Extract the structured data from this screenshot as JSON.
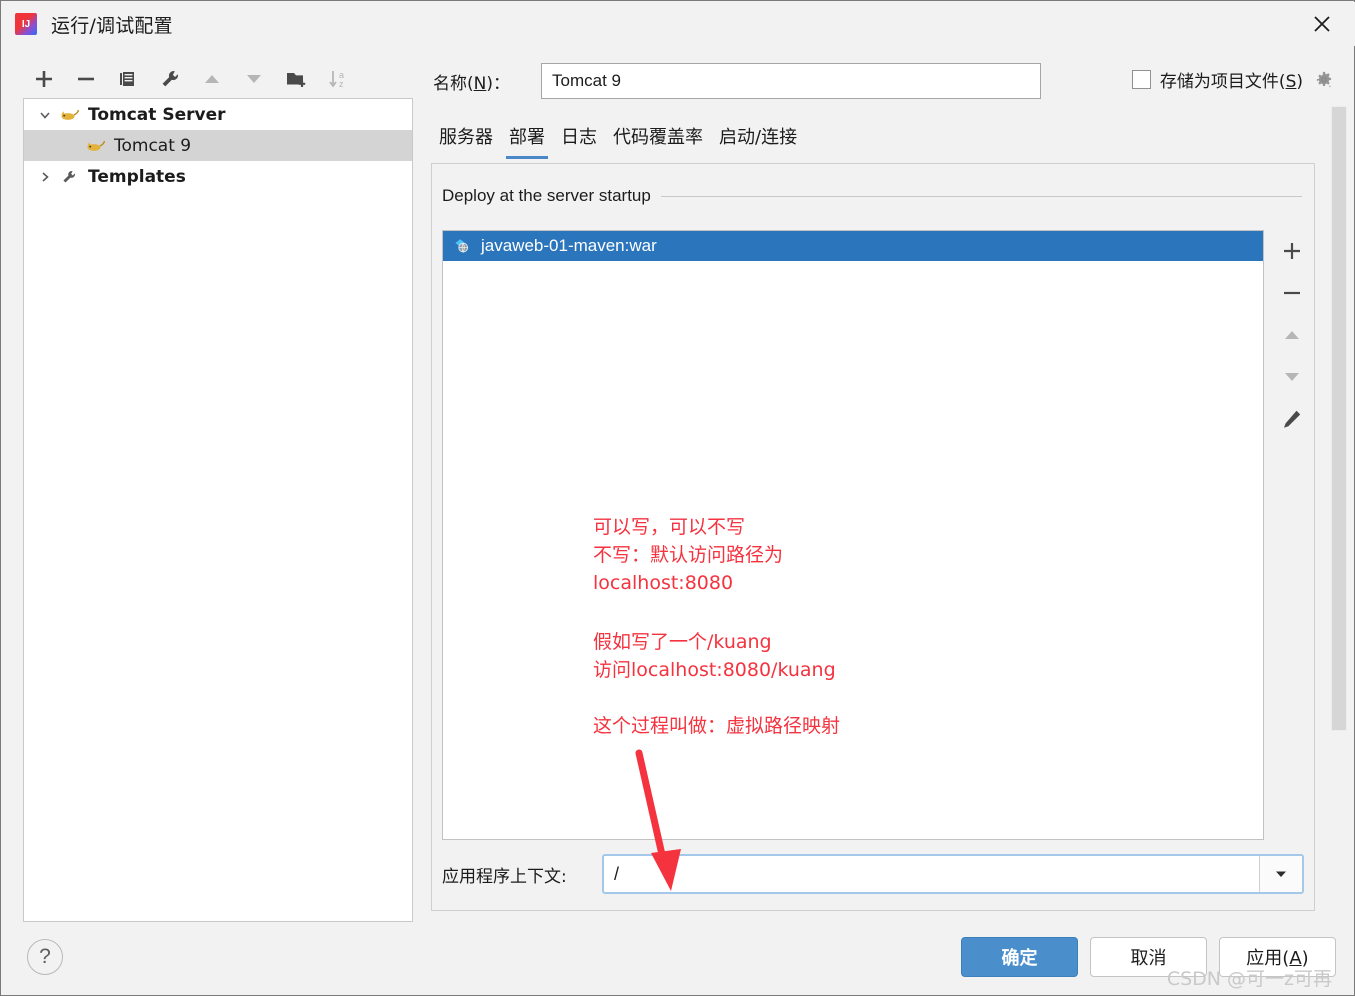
{
  "window": {
    "title": "运行/调试配置",
    "app_icon": "intellij-idea-icon",
    "close_label": "×"
  },
  "left_toolbar": {
    "buttons": [
      {
        "name": "add-configuration-button",
        "icon": "plus-icon",
        "enabled": true
      },
      {
        "name": "remove-configuration-button",
        "icon": "minus-icon",
        "enabled": true
      },
      {
        "name": "copy-configuration-button",
        "icon": "copy-icon",
        "enabled": true
      },
      {
        "name": "edit-templates-button",
        "icon": "wrench-icon",
        "enabled": true
      },
      {
        "name": "move-up-button",
        "icon": "arrow-up-icon",
        "enabled": false
      },
      {
        "name": "move-down-button",
        "icon": "arrow-down-icon",
        "enabled": false
      },
      {
        "name": "new-folder-button",
        "icon": "folder-add-icon",
        "enabled": true
      },
      {
        "name": "sort-alphabetically-button",
        "icon": "sort-az-icon",
        "enabled": false
      }
    ]
  },
  "tree": {
    "items": [
      {
        "label": "Tomcat Server",
        "icon": "tomcat-cat-icon",
        "twisty": "chevron-down-icon",
        "bold": true,
        "selected": false,
        "child": false
      },
      {
        "label": "Tomcat 9",
        "icon": "tomcat-cat-icon",
        "twisty": "",
        "bold": false,
        "selected": true,
        "child": true
      },
      {
        "label": "Templates",
        "icon": "wrench-icon",
        "twisty": "chevron-right-icon",
        "bold": true,
        "selected": false,
        "child": false
      }
    ]
  },
  "name_field": {
    "label_prefix": "名称(",
    "label_mnemonic": "N",
    "label_suffix": ")：",
    "value": "Tomcat 9",
    "placeholder": ""
  },
  "store_as_project_file": {
    "checked": false,
    "label_prefix": "存储为项目文件(",
    "label_mnemonic": "S",
    "label_suffix": ")",
    "gear_icon": "gear-dropdown-icon"
  },
  "tabs": [
    {
      "label": "服务器",
      "active": false
    },
    {
      "label": "部署",
      "active": true
    },
    {
      "label": "日志",
      "active": false
    },
    {
      "label": "代码覆盖率",
      "active": false
    },
    {
      "label": "启动/连接",
      "active": false
    }
  ],
  "deploy": {
    "section_title": "Deploy at the server startup",
    "items": [
      {
        "label": "javaweb-01-maven:war",
        "icon": "artifact-war-icon",
        "selected": true
      }
    ],
    "side_tools": [
      {
        "name": "add-artifact-button",
        "icon": "plus-icon",
        "enabled": true
      },
      {
        "name": "remove-artifact-button",
        "icon": "minus-icon",
        "enabled": true
      },
      {
        "name": "move-artifact-up-button",
        "icon": "arrow-up-icon",
        "enabled": false
      },
      {
        "name": "move-artifact-down-button",
        "icon": "arrow-down-icon",
        "enabled": false
      },
      {
        "name": "edit-artifact-button",
        "icon": "pencil-icon",
        "enabled": true
      }
    ],
    "context_field": {
      "label": "应用程序上下文:",
      "value": "/",
      "placeholder": "",
      "dropdown_icon": "chevron-down-icon"
    }
  },
  "annotations": [
    {
      "id": "note-1",
      "text": "可以写，可以不写\n不写：默认访问路径为\nlocalhost:8080"
    },
    {
      "id": "note-2",
      "text": "假如写了一个/kuang\n访问localhost:8080/kuang"
    },
    {
      "id": "note-3",
      "text": "这个过程叫做：虚拟路径映射"
    }
  ],
  "buttons": {
    "help": "?",
    "ok": "确定",
    "cancel": "取消",
    "apply_prefix": "应用(",
    "apply_mnemonic": "A",
    "apply_suffix": ")"
  },
  "watermark": "CSDN @可一z可再",
  "colors": {
    "selection_blue": "#2a75bc",
    "tab_underline": "#4a88c7",
    "primary_button": "#4a8ecc",
    "annotation_red": "#f5333f",
    "dialog_background": "#f2f2f2",
    "tree_selection_gray": "#d4d4d4",
    "focus_border": "#a5c8ea"
  }
}
